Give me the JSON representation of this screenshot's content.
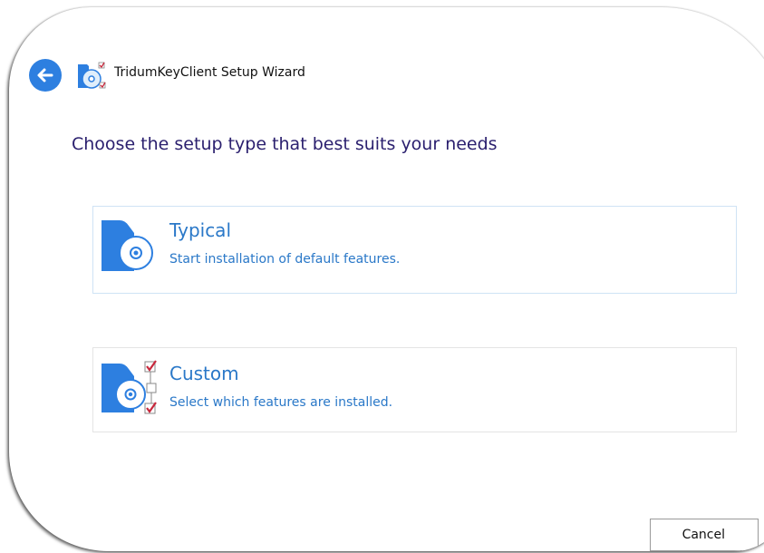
{
  "window": {
    "title": "TridumKeyClient Setup Wizard",
    "icons": {
      "back": "arrow-left-icon",
      "app": "setup-disc-icon"
    }
  },
  "main": {
    "heading": "Choose the setup type that best suits your needs",
    "options": [
      {
        "title": "Typical",
        "description": "Start installation of default features.",
        "icon": "disc-folder-icon"
      },
      {
        "title": "Custom",
        "description": "Select which features are installed.",
        "icon": "disc-folder-checklist-icon"
      }
    ]
  },
  "footer": {
    "cancel_label": "Cancel"
  },
  "colors": {
    "accent": "#2d7fe0",
    "heading": "#2a1f6e",
    "option_text": "#2a78c8",
    "check": "#c8283c"
  }
}
